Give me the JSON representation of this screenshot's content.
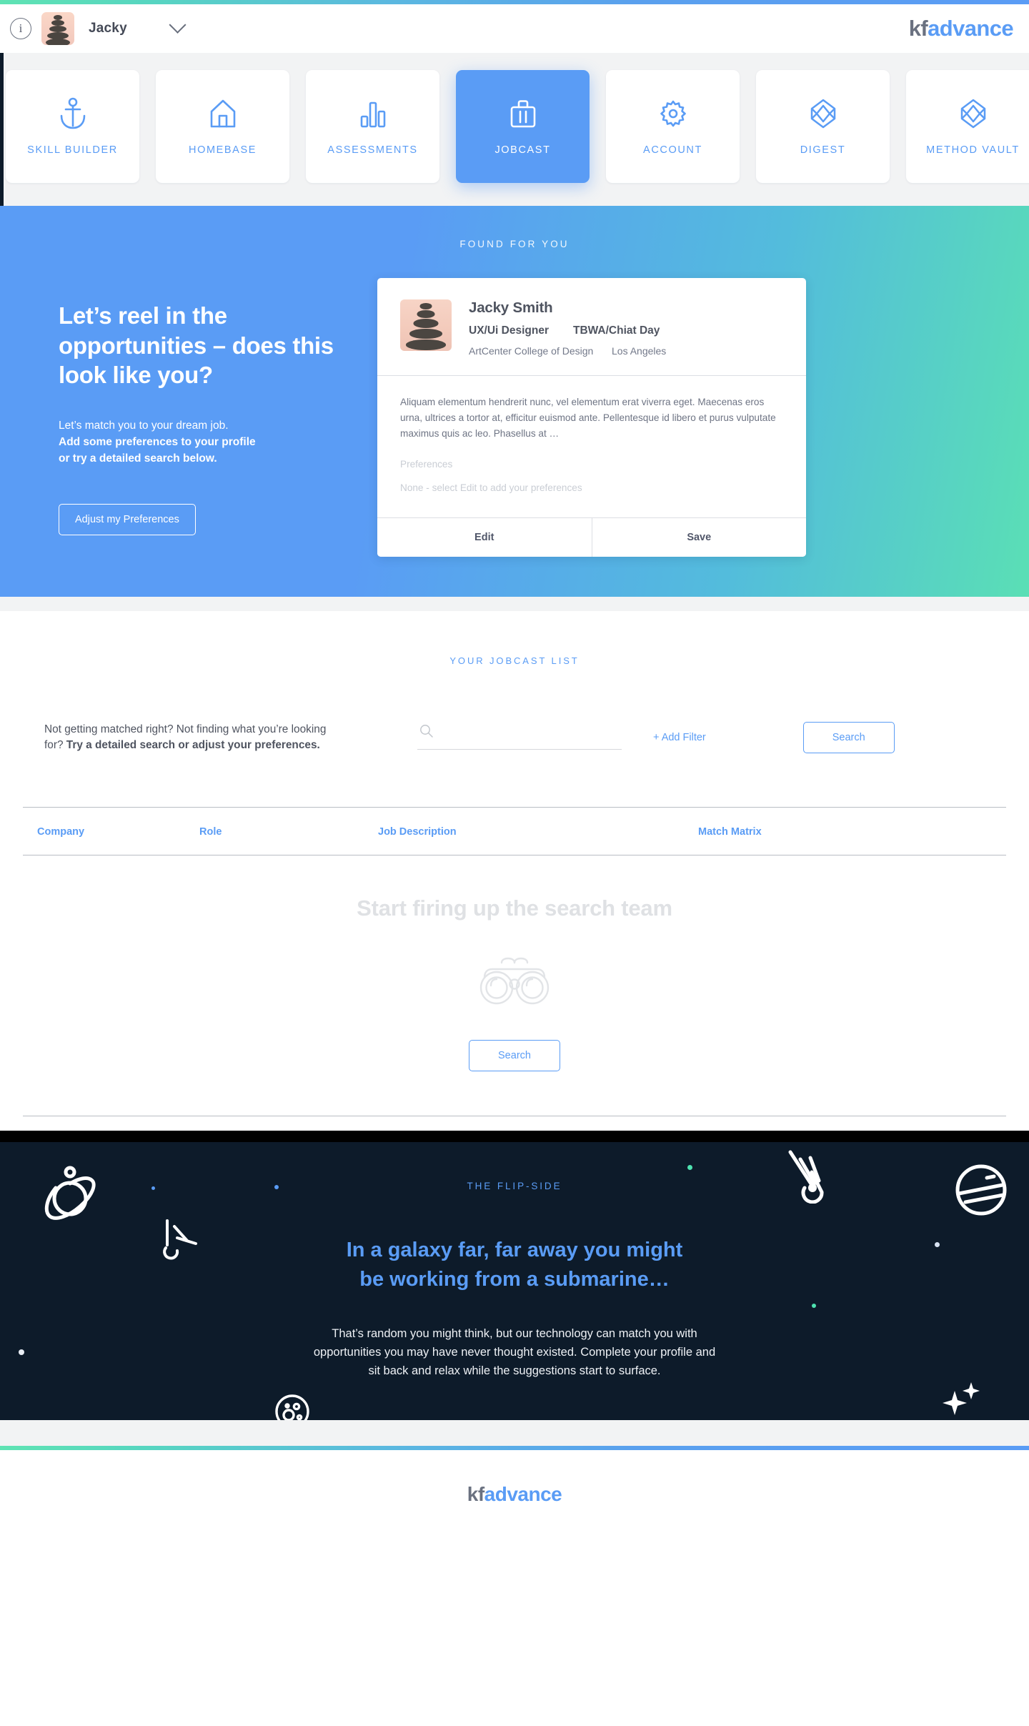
{
  "brand": {
    "prefix": "kf",
    "suffix": "advance"
  },
  "header": {
    "info_icon": "info-icon",
    "user_name": "Jacky",
    "chevron": "chevron-down-icon"
  },
  "nav": {
    "items": [
      {
        "label": "SKILL BUILDER",
        "icon": "anchor-icon",
        "active": false
      },
      {
        "label": "HOMEBASE",
        "icon": "home-icon",
        "active": false
      },
      {
        "label": "ASSESSMENTS",
        "icon": "bar-chart-icon",
        "active": false
      },
      {
        "label": "JOBCAST",
        "icon": "briefcase-icon",
        "active": true
      },
      {
        "label": "ACCOUNT",
        "icon": "gear-icon",
        "active": false
      },
      {
        "label": "DIGEST",
        "icon": "diamond-cube-icon",
        "active": false
      },
      {
        "label": "METHOD VAULT",
        "icon": "diamond-cube-icon",
        "active": false
      }
    ]
  },
  "hero": {
    "eyebrow": "FOUND FOR YOU",
    "title": "Let’s reel in the opportunities – does this look like you?",
    "sub_line1": "Let’s match you to your dream job.",
    "sub_line2": "Add some preferences to your profile",
    "sub_line3": "or try a detailed search below.",
    "cta": "Adjust my Preferences",
    "gradient_start": "#5a9cf5",
    "gradient_end": "#5adfb5"
  },
  "profile_card": {
    "avatar": "stacked-stones-photo",
    "name": "Jacky Smith",
    "role": "UX/Ui Designer",
    "company": "TBWA/Chiat Day",
    "school": "ArtCenter College of Design",
    "location": "Los Angeles",
    "bio": "Aliquam elementum hendrerit nunc, vel elementum erat viverra eget. Maecenas eros urna, ultrices a tortor at, efficitur euismod ante. Pellentesque id libero et purus vulputate maximus quis ac leo. Phasellus at …",
    "preferences_label": "Preferences",
    "preferences_value": "None - select Edit to add your preferences",
    "edit_label": "Edit",
    "save_label": "Save"
  },
  "jobcast": {
    "eyebrow": "YOUR JOBCAST LIST",
    "blurb_plain": "Not getting matched right? Not finding what you’re looking for? ",
    "blurb_bold": "Try a detailed search or adjust your preferences.",
    "search_placeholder": "",
    "search_value": "",
    "search_icon": "search-icon",
    "add_filter_label": "+ Add Filter",
    "search_button_label": "Search",
    "columns": [
      "Company",
      "Role",
      "Job Description",
      "Match Matrix"
    ],
    "rows": [],
    "empty_title": "Start firing up the search team",
    "empty_icon": "binoculars-icon",
    "empty_button_label": "Search"
  },
  "flipside": {
    "eyebrow": "THE FLIP-SIDE",
    "title_line1": "In a galaxy far, far away you might",
    "title_line2": "be working from a submarine…",
    "body": "That’s random you might think, but our technology can match you with opportunities you may have never thought existed. Complete your profile and sit back and relax while the suggestions start to surface.",
    "background": "#0d1b2a",
    "accent": "#5a9cf5",
    "decorations": [
      "saturn-planet-icon",
      "comet-icon",
      "crater-planet-icon",
      "striped-planet-icon",
      "moon-icon",
      "sparkle-stars-icon"
    ]
  },
  "footer": {
    "brand_prefix": "kf",
    "brand_suffix": "advance"
  }
}
